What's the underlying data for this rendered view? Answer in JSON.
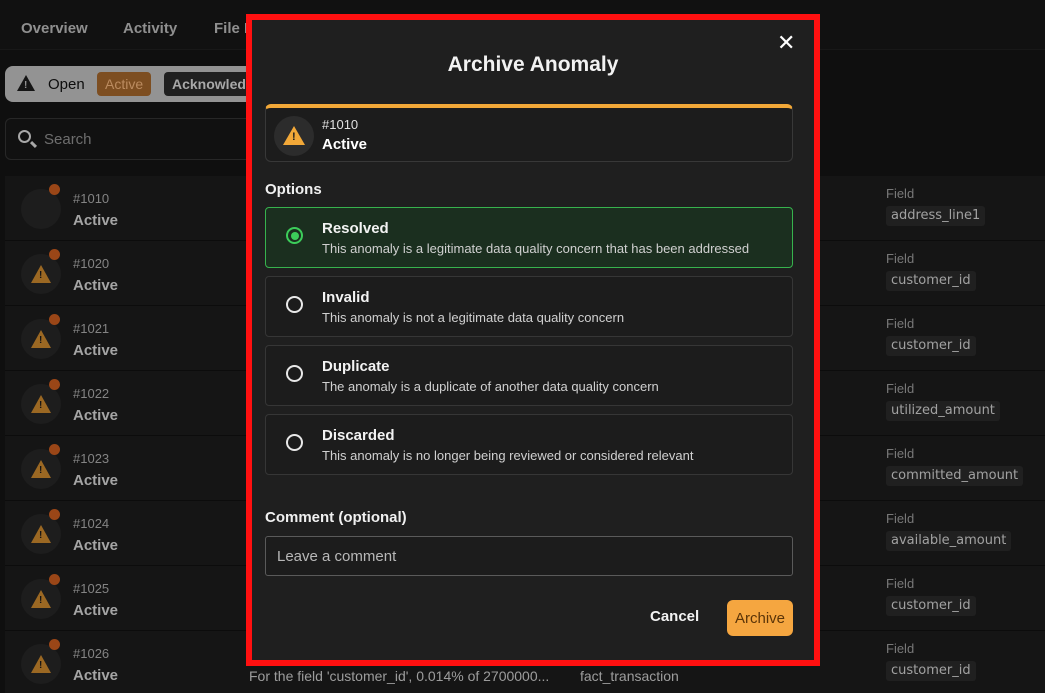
{
  "nav": {
    "tabs": [
      "Overview",
      "Activity",
      "File P"
    ]
  },
  "filters": {
    "status_label": "Open",
    "active_chip": "Active",
    "acknowledged_chip": "Acknowledge"
  },
  "search": {
    "placeholder": "Search"
  },
  "list": {
    "rows": [
      {
        "id": "#1010",
        "status": "Active",
        "field_label": "Field",
        "field": "address_line1",
        "icon": "blank-avatar"
      },
      {
        "id": "#1020",
        "status": "Active",
        "field_label": "Field",
        "field": "customer_id",
        "icon": "warning-icon"
      },
      {
        "id": "#1021",
        "status": "Active",
        "field_label": "Field",
        "field": "customer_id",
        "icon": "warning-icon"
      },
      {
        "id": "#1022",
        "status": "Active",
        "field_label": "Field",
        "field": "utilized_amount",
        "icon": "warning-icon"
      },
      {
        "id": "#1023",
        "status": "Active",
        "field_label": "Field",
        "field": "committed_amount",
        "icon": "warning-icon"
      },
      {
        "id": "#1024",
        "status": "Active",
        "field_label": "Field",
        "field": "available_amount",
        "icon": "warning-icon"
      },
      {
        "id": "#1025",
        "status": "Active",
        "field_label": "Field",
        "field": "customer_id",
        "icon": "warning-icon"
      },
      {
        "id": "#1026",
        "status": "Active",
        "field_label": "Field",
        "field": "customer_id",
        "icon": "warning-icon",
        "description": "For the field 'customer_id', 0.014% of 2700000...",
        "table": "fact_transaction"
      }
    ]
  },
  "modal": {
    "title": "Archive Anomaly",
    "close_icon": "close-icon",
    "anomaly_id": "#1010",
    "anomaly_status": "Active",
    "options_label": "Options",
    "options": [
      {
        "name": "Resolved",
        "desc": "This anomaly is a legitimate data quality concern that has been addressed",
        "selected": true
      },
      {
        "name": "Invalid",
        "desc": "This anomaly is not a legitimate data quality concern",
        "selected": false
      },
      {
        "name": "Duplicate",
        "desc": "The anomaly is a duplicate of another data quality concern",
        "selected": false
      },
      {
        "name": "Discarded",
        "desc": "This anomaly is no longer being reviewed or considered relevant",
        "selected": false
      }
    ],
    "comment_label": "Comment (optional)",
    "comment_placeholder": "Leave a comment",
    "cancel_label": "Cancel",
    "archive_label": "Archive"
  },
  "colors": {
    "accent": "#f5a640",
    "selected_border": "#37b24d",
    "highlight": "#ff1010",
    "notification_dot": "#c65a1e"
  }
}
